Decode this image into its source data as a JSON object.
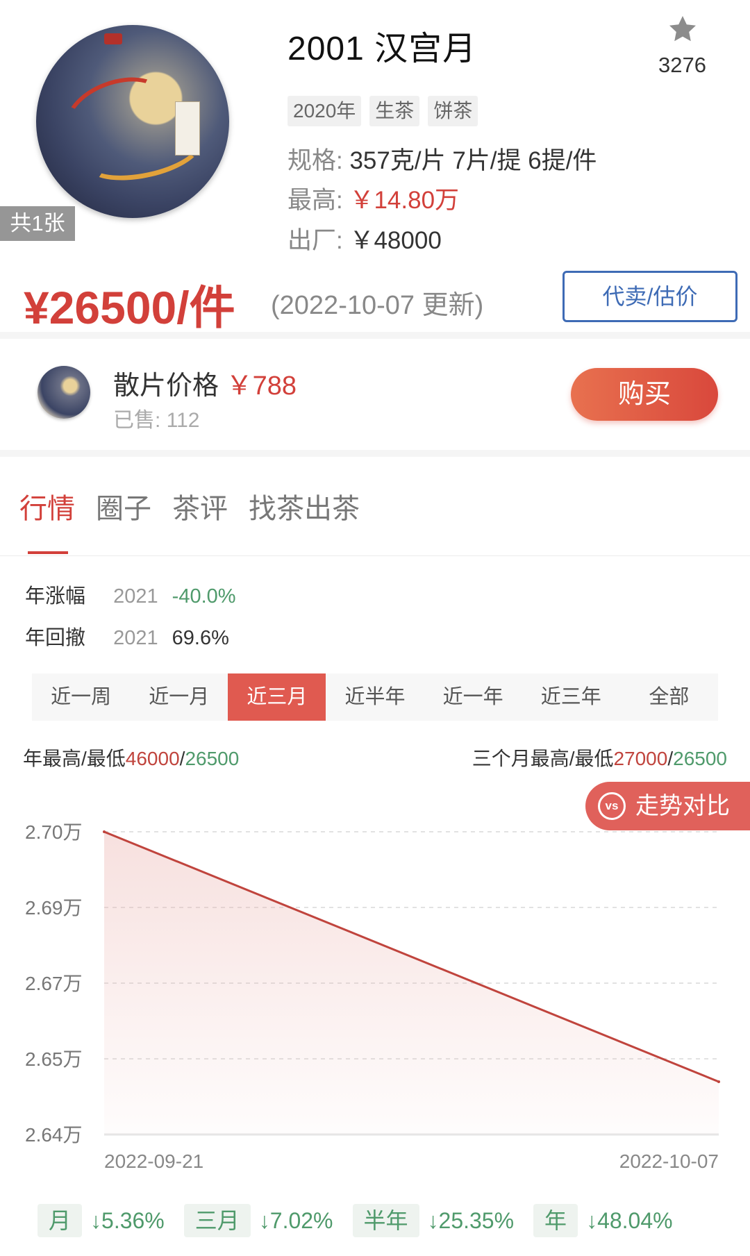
{
  "product": {
    "title": "2001 汉宫月",
    "image_count": "共1张",
    "favorite_count": "3276",
    "tags": [
      "2020年",
      "生茶",
      "饼茶"
    ],
    "spec_key": "规格:",
    "spec_value": "357克/片 7片/提 6提/件",
    "highest_key": "最高:",
    "highest_value": "￥14.80万",
    "factory_key": "出厂:",
    "factory_value": "￥48000",
    "price": "¥26500/件",
    "updated": "(2022-10-07 更新)",
    "consign_button": "代卖/估价"
  },
  "loose": {
    "label": "散片价格",
    "price": "￥788",
    "sold": "已售: 112",
    "buy_button": "购买"
  },
  "tabs": [
    "行情",
    "圈子",
    "茶评",
    "找茶出茶"
  ],
  "stats": {
    "yearly_change_label": "年涨幅",
    "yearly_change_year": "2021",
    "yearly_change_value": "-40.0%",
    "yearly_drawdown_label": "年回撤",
    "yearly_drawdown_year": "2021",
    "yearly_drawdown_value": "69.6%"
  },
  "periods": [
    "近一周",
    "近一月",
    "近三月",
    "近半年",
    "近一年",
    "近三年",
    "全部"
  ],
  "active_period": "近三月",
  "range": {
    "year_label": "年最高/最低",
    "year_high": "46000",
    "year_low": "26500",
    "sep": "/",
    "three_month_label": "三个月最高/最低",
    "three_month_high": "27000",
    "three_month_low": "26500"
  },
  "compare_button": "走势对比",
  "compare_icon": "vs",
  "chart_data": {
    "type": "area",
    "x": [
      "2022-09-21",
      "2022-10-07"
    ],
    "y": [
      27000,
      26500
    ],
    "y_ticks": [
      "2.70万",
      "2.69万",
      "2.67万",
      "2.65万",
      "2.64万"
    ],
    "ylim": [
      26400,
      27000
    ],
    "grid": true,
    "line_color": "#c0443d"
  },
  "changes": [
    {
      "label": "月",
      "value": "↓5.36%"
    },
    {
      "label": "三月",
      "value": "↓7.02%"
    },
    {
      "label": "半年",
      "value": "↓25.35%"
    },
    {
      "label": "年",
      "value": "↓48.04%"
    }
  ]
}
